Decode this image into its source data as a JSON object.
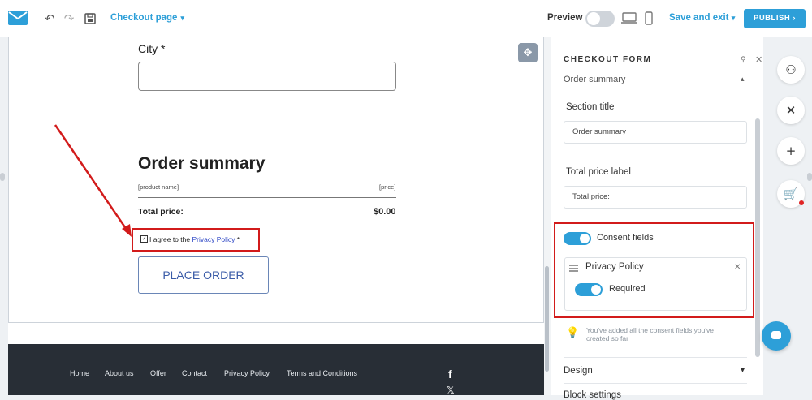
{
  "topbar": {
    "page_name": "Checkout page",
    "preview_label": "Preview",
    "save_exit_label": "Save and exit",
    "publish_label": "PUBLISH",
    "icons": [
      "envelope-logo",
      "undo-icon",
      "redo-icon",
      "save-icon",
      "chevron-down-icon",
      "desktop-icon",
      "mobile-icon",
      "chevron-right-icon"
    ]
  },
  "canvas": {
    "city_label": "City *",
    "order_summary_title": "Order summary",
    "product_name_placeholder": "[product name]",
    "price_placeholder": "[price]",
    "total_label": "Total price:",
    "total_value": "$0.00",
    "consent_prefix": "I agree to the",
    "consent_link": "Privacy Policy",
    "consent_suffix": "*",
    "place_order_label": "PLACE ORDER"
  },
  "footer": {
    "links": [
      "Home",
      "About us",
      "Offer",
      "Contact",
      "Privacy Policy",
      "Terms and Conditions"
    ],
    "facebook_glyph": "f",
    "x_glyph": "𝕏"
  },
  "panel": {
    "title": "CHECKOUT FORM",
    "section_name": "Order summary",
    "section_title_label": "Section title",
    "section_title_value": "Order summary",
    "total_price_label": "Total price label",
    "total_price_value": "Total price:",
    "consent_fields_label": "Consent fields",
    "privacy_policy_label": "Privacy Policy",
    "required_label": "Required",
    "hint_text": "You've added all the consent fields you've created so far",
    "design_label": "Design",
    "block_label": "Block settings"
  },
  "colors": {
    "accent": "#2d9fd8",
    "highlight": "#d21b1b",
    "footer_bg": "#282e36"
  }
}
